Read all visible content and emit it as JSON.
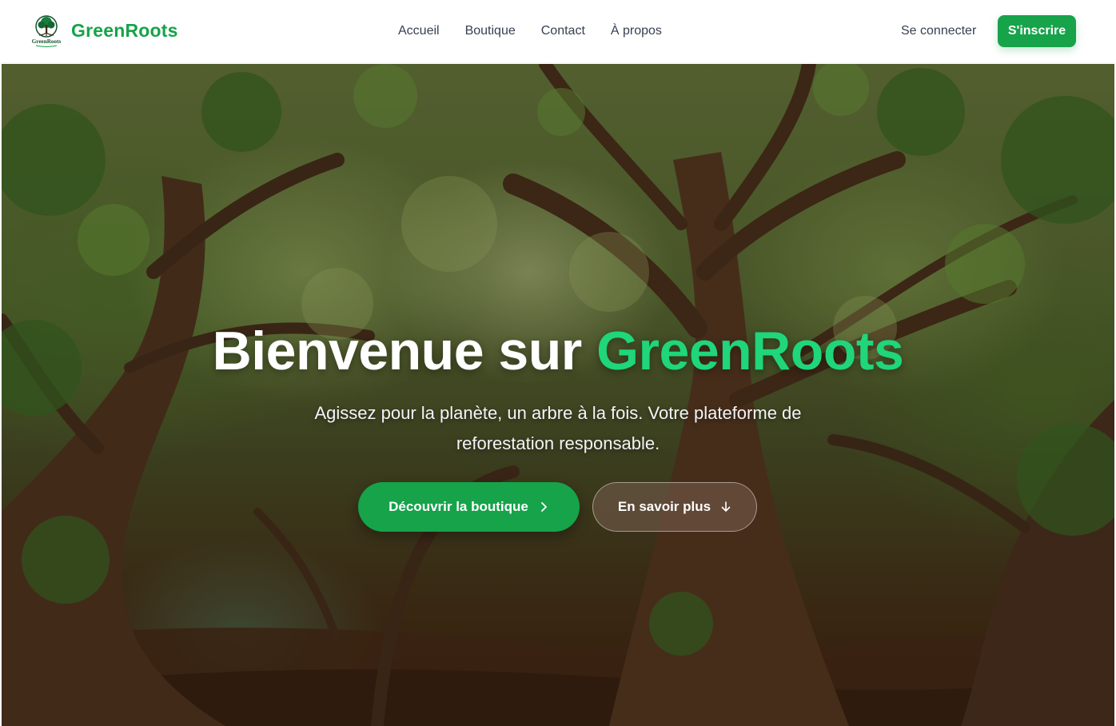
{
  "header": {
    "logo_text": "GreenRoots",
    "brand_name": "GreenRoots",
    "nav": [
      {
        "label": "Accueil"
      },
      {
        "label": "Boutique"
      },
      {
        "label": "Contact"
      },
      {
        "label": "À propos"
      }
    ],
    "login_label": "Se connecter",
    "signup_label": "S'inscrire"
  },
  "hero": {
    "title_prefix": "Bienvenue sur ",
    "title_accent": "GreenRoots",
    "subtitle": "Agissez pour la planète, un arbre à la fois. Votre plateforme de reforestation responsable.",
    "primary_cta": {
      "label": "Découvrir la boutique",
      "icon": "chevron-right-icon"
    },
    "secondary_cta": {
      "label": "En savoir plus",
      "icon": "arrow-down-icon"
    }
  },
  "colors": {
    "brand": "#16a34a",
    "accent": "#1fd67a",
    "text": "#374151"
  }
}
